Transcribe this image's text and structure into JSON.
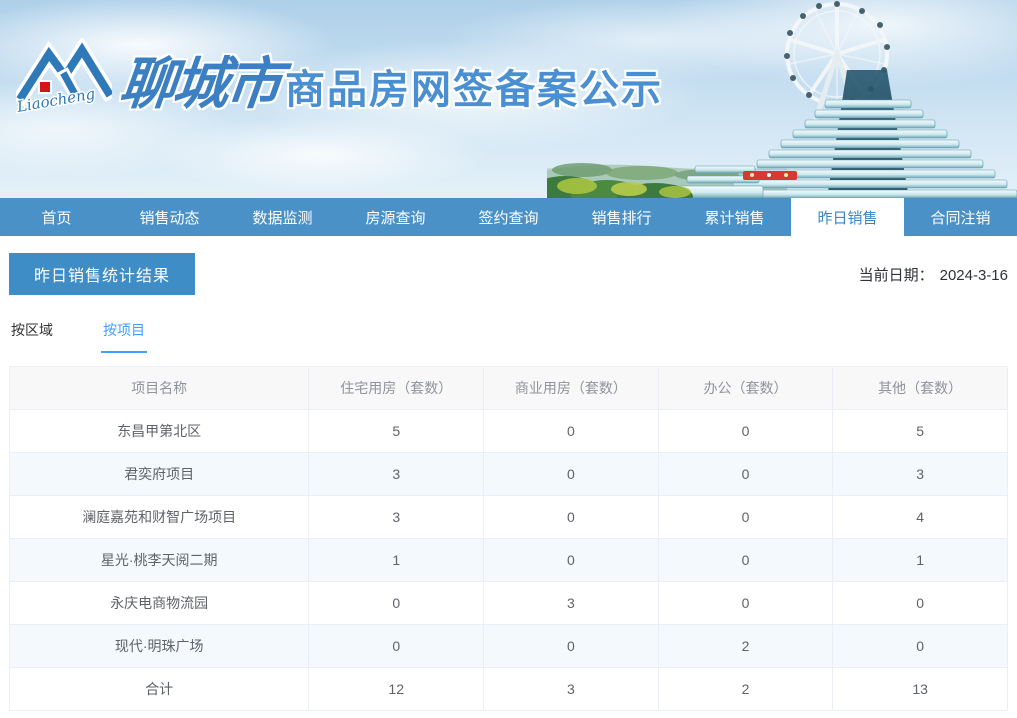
{
  "colors": {
    "nav_blue": "#4a91c7",
    "nav_active_text": "#3a86c5",
    "title_box_blue": "#3f8dc6",
    "tab_active_blue": "#409eff",
    "banner_title_blue": "#4a8fd2",
    "table_border": "#ebeef5",
    "table_header_bg": "#f8f8f9",
    "table_header_text": "#8f939a",
    "table_cell_text": "#5f6368",
    "table_stripe_bg": "#f3f9fd"
  },
  "banner": {
    "logo_icon": "liaocheng-roof-m-logo",
    "logo_script": "Liaocheng",
    "city_calligraphy": "聊城市",
    "site_title": "商品房网签备案公示",
    "scene_icon": "ferris-wheel-hotel-skyline"
  },
  "nav": {
    "items": [
      {
        "id": "home",
        "label": "首页",
        "active": false
      },
      {
        "id": "sales-dynamics",
        "label": "销售动态",
        "active": false
      },
      {
        "id": "data-monitoring",
        "label": "数据监测",
        "active": false
      },
      {
        "id": "listing-query",
        "label": "房源查询",
        "active": false
      },
      {
        "id": "signing-query",
        "label": "签约查询",
        "active": false
      },
      {
        "id": "sales-ranking",
        "label": "销售排行",
        "active": false
      },
      {
        "id": "cumulative-sales",
        "label": "累计销售",
        "active": false
      },
      {
        "id": "yesterday-sales",
        "label": "昨日销售",
        "active": true
      },
      {
        "id": "contract-cancellation",
        "label": "合同注销",
        "active": false
      }
    ]
  },
  "page": {
    "section_title": "昨日销售统计结果",
    "date_label": "当前日期：",
    "date_value": "2024-3-16",
    "tabs": [
      {
        "id": "by-region",
        "label": "按区域",
        "active": false
      },
      {
        "id": "by-project",
        "label": "按项目",
        "active": true
      }
    ]
  },
  "table": {
    "columns": [
      "项目名称",
      "住宅用房（套数）",
      "商业用房（套数）",
      "办公（套数）",
      "其他（套数）"
    ],
    "rows": [
      [
        "东昌甲第北区",
        "5",
        "0",
        "0",
        "5"
      ],
      [
        "君奕府项目",
        "3",
        "0",
        "0",
        "3"
      ],
      [
        "澜庭嘉苑和财智广场项目",
        "3",
        "0",
        "0",
        "4"
      ],
      [
        "星光·桃李天阅二期",
        "1",
        "0",
        "0",
        "1"
      ],
      [
        "永庆电商物流园",
        "0",
        "3",
        "0",
        "0"
      ],
      [
        "现代·明珠广场",
        "0",
        "0",
        "2",
        "0"
      ],
      [
        "合计",
        "12",
        "3",
        "2",
        "13"
      ]
    ]
  }
}
